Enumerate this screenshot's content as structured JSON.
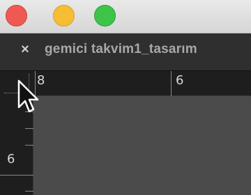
{
  "window": {
    "tab_title": "gemici takvim1_tasarım",
    "tab_close_glyph": "×"
  },
  "rulers": {
    "horizontal_labels": [
      "8",
      "6"
    ],
    "vertical_labels": [
      "6"
    ]
  },
  "colors": {
    "close": "#ee5a52",
    "minimize": "#f4bd33",
    "maximize": "#3fc44a",
    "canvas": "#4b4b4b",
    "ruler_bg": "#1e1e1e"
  },
  "icons": {
    "cursor": "arrow-pointer-icon"
  }
}
